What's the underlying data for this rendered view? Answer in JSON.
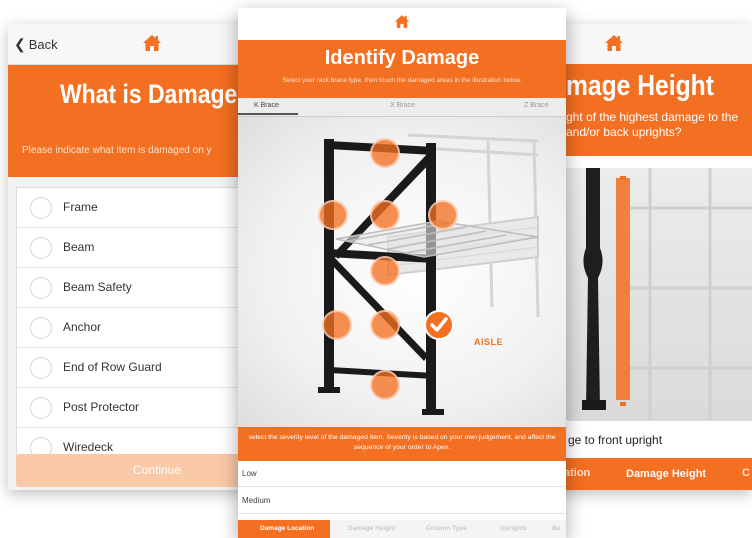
{
  "left_screen": {
    "back_label": "Back",
    "title": "What is Damaged",
    "subtitle": "Please indicate what item is damaged on y",
    "items": [
      "Frame",
      "Beam",
      "Beam Safety",
      "Anchor",
      "End of Row Guard",
      "Post Protector",
      "Wiredeck"
    ],
    "continue_label": "Continue"
  },
  "center_screen": {
    "title": "Identify Damage",
    "subtitle": "Select your rack brace type, then touch the damaged areas in the illustration below.",
    "tabs": [
      "K Brace",
      "X Brace",
      "Z Brace"
    ],
    "aisle_label": "AISLE",
    "severity_text": "select the severity level of the damaged item. Severity is based on your own judgement, and affect the sequence of your order to Apex.",
    "options": [
      "Low",
      "Medium"
    ],
    "steps": [
      "Damage Location",
      "Damage Height",
      "Column Type",
      "Uprights",
      "Ba"
    ]
  },
  "right_screen": {
    "title": "mage Height",
    "subtitle_line1": "ght of the highest damage to the",
    "subtitle_line2": "and/or back uprights?",
    "answer": "ge to front upright",
    "steps": [
      "ation",
      "Damage Height",
      "C"
    ]
  },
  "colors": {
    "accent": "#f36f21",
    "accent_light": "#f9c9a8"
  },
  "icons": {
    "home": "home-icon",
    "back": "chevron-left-icon",
    "check": "check-icon"
  }
}
